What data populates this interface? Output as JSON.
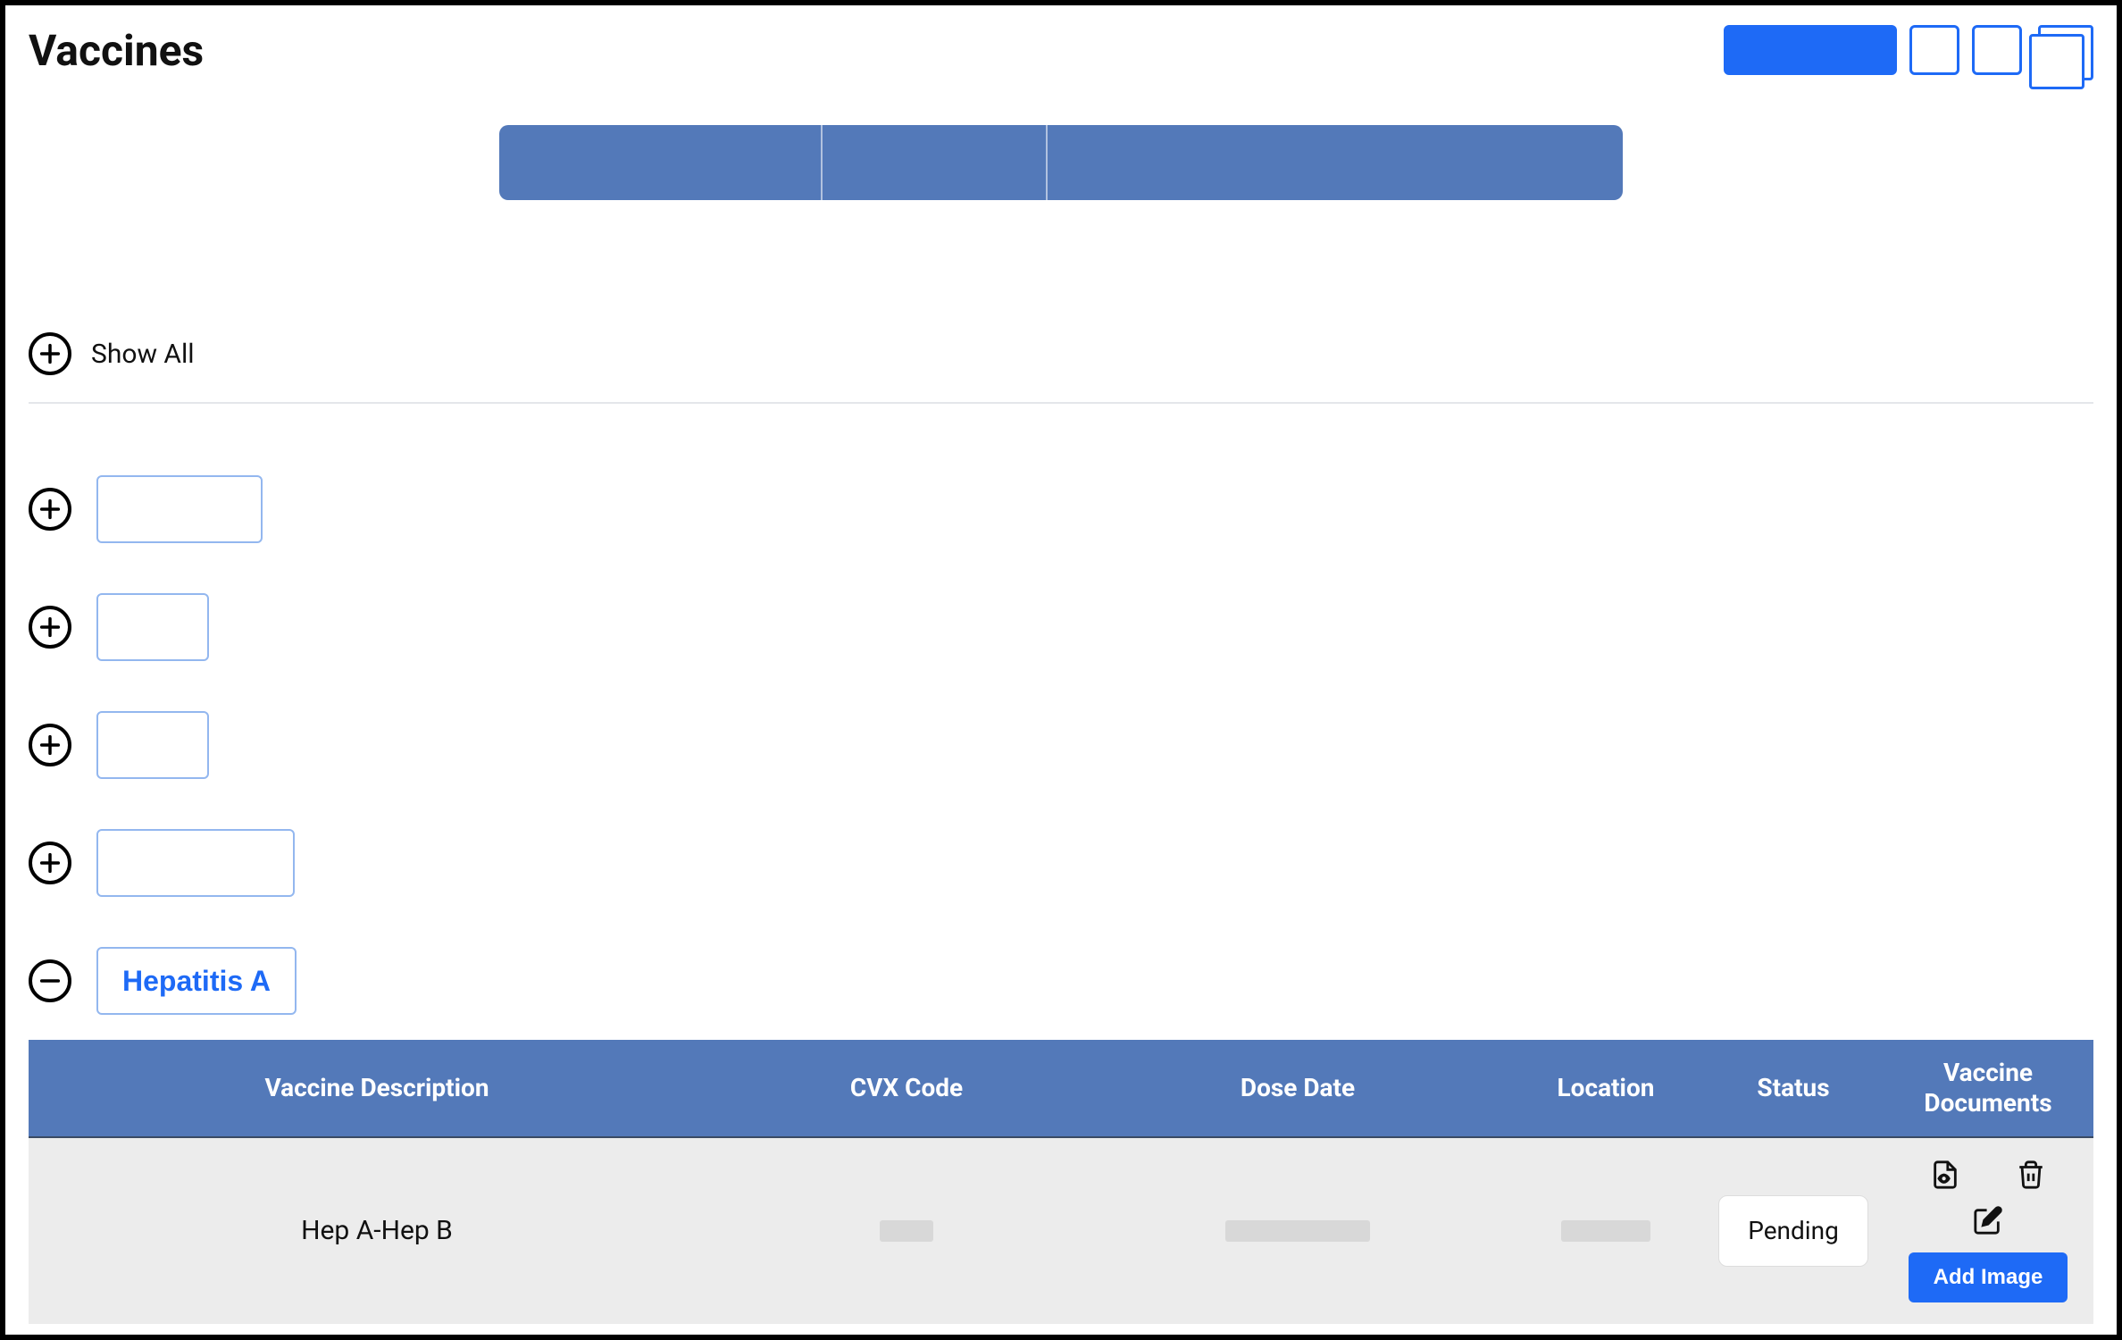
{
  "title": "Vaccines",
  "showAll": {
    "label": "Show All"
  },
  "categories": [
    {
      "expanded": false,
      "chipSize": "s1",
      "label": ""
    },
    {
      "expanded": false,
      "chipSize": "s2",
      "label": ""
    },
    {
      "expanded": false,
      "chipSize": "s3",
      "label": ""
    },
    {
      "expanded": false,
      "chipSize": "s4",
      "label": ""
    },
    {
      "expanded": true,
      "chipSize": "label",
      "label": "Hepatitis A"
    }
  ],
  "table": {
    "columns": {
      "desc": "Vaccine Description",
      "cvx": "CVX Code",
      "date": "Dose Date",
      "loc": "Location",
      "status": "Status",
      "docs": "Vaccine Documents"
    },
    "rows": [
      {
        "desc": "Hep A-Hep B",
        "cvx": "",
        "date": "",
        "loc": "",
        "status": "Pending",
        "addImageLabel": "Add Image"
      }
    ]
  }
}
